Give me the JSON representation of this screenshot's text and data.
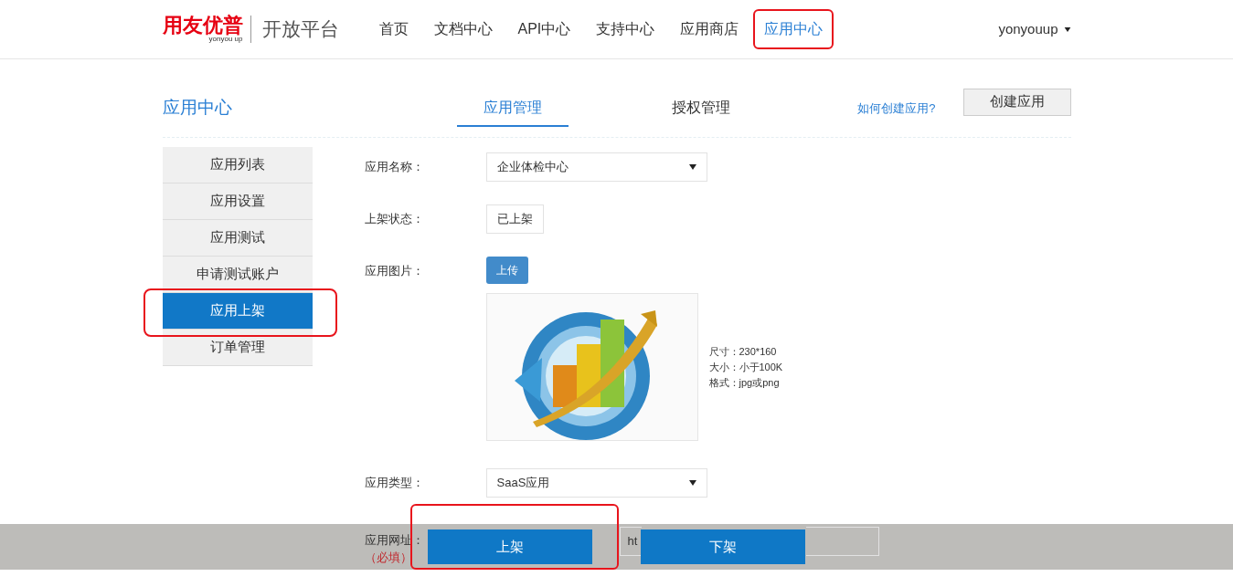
{
  "header": {
    "logo": "用友优普",
    "logo_sub": "yonyou up",
    "platform": "开放平台",
    "user": "yonyouup",
    "nav": [
      {
        "label": "首页",
        "selected": false,
        "highlighted": false
      },
      {
        "label": "文档中心",
        "selected": false,
        "highlighted": false
      },
      {
        "label": "API中心",
        "selected": false,
        "highlighted": false
      },
      {
        "label": "支持中心",
        "selected": false,
        "highlighted": false
      },
      {
        "label": "应用商店",
        "selected": false,
        "highlighted": false
      },
      {
        "label": "应用中心",
        "selected": true,
        "highlighted": true
      }
    ]
  },
  "section_title": "应用中心",
  "tabs": [
    {
      "label": "应用管理",
      "selected": true
    },
    {
      "label": "授权管理",
      "selected": false
    }
  ],
  "help_link": "如何创建应用?",
  "create_button": "创建应用",
  "sidebar": [
    {
      "label": "应用列表",
      "selected": false,
      "highlighted": false
    },
    {
      "label": "应用设置",
      "selected": false,
      "highlighted": false
    },
    {
      "label": "应用测试",
      "selected": false,
      "highlighted": false
    },
    {
      "label": "申请测试账户",
      "selected": false,
      "highlighted": false
    },
    {
      "label": "应用上架",
      "selected": true,
      "highlighted": true
    },
    {
      "label": "订单管理",
      "selected": false,
      "highlighted": false
    }
  ],
  "form": {
    "name_label": "应用名称：",
    "name_value": "企业体检中心",
    "status_label": "上架状态：",
    "status_value": "已上架",
    "image_label": "应用图片：",
    "upload_button": "上传",
    "image_notes": [
      "尺寸：230*160",
      "大小：小于100K",
      "格式：jpg或png"
    ],
    "type_label": "应用类型：",
    "type_value": "SaaS应用",
    "url_label": "应用网址：",
    "url_required": "（必填）",
    "url_value": "ht"
  },
  "actions": [
    {
      "label": "上架",
      "highlighted": true
    },
    {
      "label": "下架",
      "highlighted": false
    }
  ]
}
